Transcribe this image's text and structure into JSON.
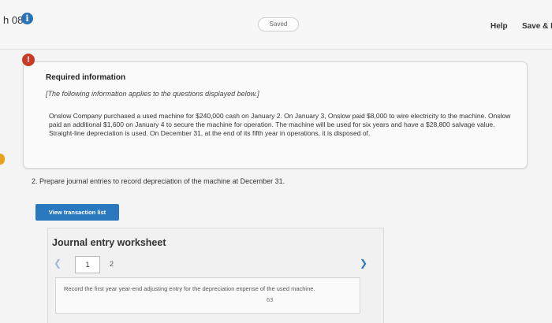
{
  "header": {
    "question_number": "h 08",
    "saved_label": "Saved",
    "help_label": "Help",
    "save_exit_label": "Save & E"
  },
  "info": {
    "title": "Required information",
    "note": "[The following information applies to the questions displayed below.]",
    "body": "Onslow Company purchased a used machine for $240,000 cash on January 2. On January 3, Onslow paid $8,000 to wire electricity to the machine. Onslow paid an additional $1,600 on January 4 to secure the machine for operation. The machine will be used for six years and have a $28,800 salvage value. Straight-line depreciation is used. On December 31, at the end of its fifth year in operations, it is disposed of."
  },
  "question": {
    "text": "2. Prepare journal entries to record depreciation of the machine at December 31."
  },
  "actions": {
    "view_transactions_label": "View transaction list"
  },
  "worksheet": {
    "title": "Journal entry worksheet",
    "pages": [
      "1",
      "2"
    ],
    "instruction": "Record the first year year-end adjusting entry for the depreciation expense of the used machine.",
    "instruction_number": "63"
  },
  "colors": {
    "accent_blue": "#2a79be",
    "alert_red": "#c93a27",
    "side_tab_orange": "#e6a21c"
  },
  "icons": {
    "info": "info-icon",
    "alert": "alert-icon",
    "prev": "chevron-left-icon",
    "next": "chevron-right-icon"
  }
}
